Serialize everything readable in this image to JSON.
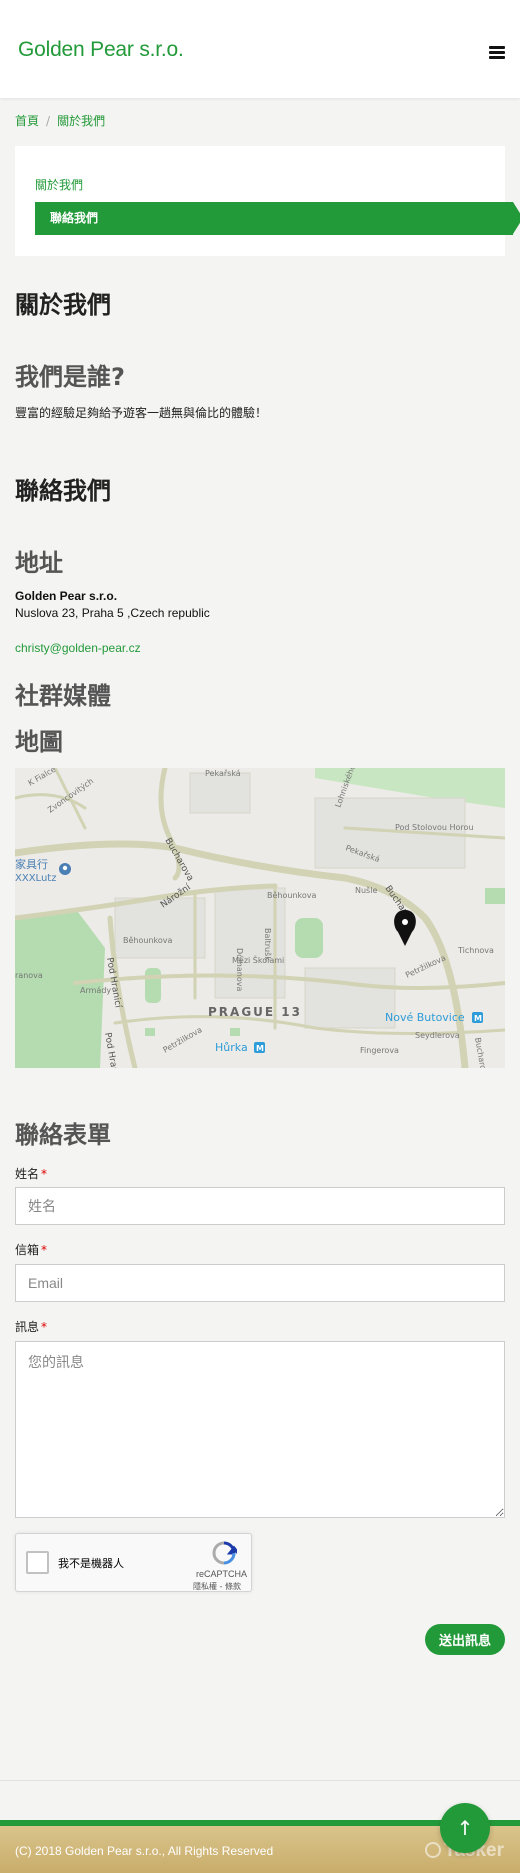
{
  "header": {
    "brand": "Golden Pear s.r.o.",
    "menu_icon": "hamburger-icon"
  },
  "breadcrumb": {
    "home": "首頁",
    "separator": "/",
    "current": "關於我們"
  },
  "subnav": {
    "link": "關於我們",
    "active": "聯絡我們"
  },
  "about": {
    "heading": "關於我們",
    "who_heading": "我們是誰?",
    "who_text": "豐富的經驗足夠給予遊客一趟無與倫比的體驗！"
  },
  "contact": {
    "heading": "聯絡我們",
    "address_heading": "地址",
    "company": "Golden Pear s.r.o.",
    "address": "Nuslova 23, Praha 5 ,Czech republic",
    "email": "christy@golden-pear.cz",
    "social_heading": "社群媒體",
    "map_heading": "地圖"
  },
  "map": {
    "labels": {
      "district": "PRAGUE 13",
      "metro_1": "Nové Butovice",
      "metro_2": "Hůrka",
      "metro_icon": "M",
      "store": "家具行",
      "store_2": "XXXLutz",
      "street_buchar": "Bucharova",
      "street_naroz": "Nárožní",
      "street_bucha2": "Bucharova",
      "street_hranici": "Pod Hranicí",
      "street_hranici2": "Pod Hranicí",
      "street_armady": "Armády",
      "street_fingerova": "Fingerova",
      "street_petrzilkova": "Petržilkova",
      "street_petrzilkova2": "Petržilkova",
      "street_seydlerova": "Seydlerova",
      "street_tichnova": "Tichnova",
      "street_mezi": "Mezi Školami",
      "street_behounkova": "Běhounkova",
      "street_behounkova2": "Běhounkova",
      "street_fialce": "K Fialce",
      "street_zvoncovitych": "Zvoncovitých",
      "street_pekarska": "Pekařská",
      "street_pekarska2": "Pekařská",
      "street_pod_stolovou": "Pod Stolovou Horou",
      "street_lohniskeho": "Lohniského",
      "street_nusle": "Nušle",
      "street_domanova": "Dómanova",
      "street_baltrusko": "Baltrušk.",
      "street_ranova": "ranova"
    },
    "marker_icon": "map-pin-icon",
    "colors": {
      "road": "#d2d2b4",
      "park": "#b4dcb0",
      "water": "#2e9cd8"
    }
  },
  "form": {
    "heading": "聯絡表單",
    "name_label": "姓名",
    "name_placeholder": "姓名",
    "email_label": "信箱",
    "email_placeholder": "Email",
    "message_label": "訊息",
    "message_placeholder": "您的訊息",
    "required_mark": "*",
    "submit_label": "送出訊息"
  },
  "recaptcha": {
    "label": "我不是機器人",
    "brand": "reCAPTCHA",
    "terms": "隱私權 - 條款",
    "icon": "recaptcha-icon"
  },
  "footer": {
    "copyright": "(C) 2018 Golden Pear s.r.o., All Rights Reserved",
    "watermark": "Tasker",
    "to_top_icon": "arrow-up-icon",
    "to_top_glyph": "↑"
  },
  "colors": {
    "accent": "#239a3a",
    "text": "#222222",
    "background": "#f4f4f2"
  }
}
